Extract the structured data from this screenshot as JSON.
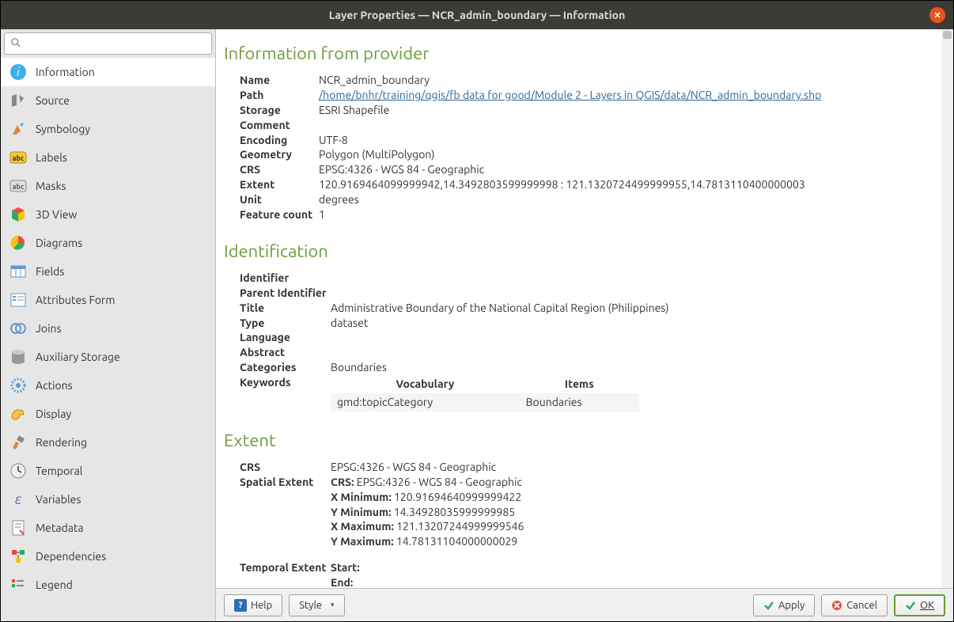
{
  "titlebar": {
    "title": "Layer Properties — NCR_admin_boundary — Information"
  },
  "search": {
    "placeholder": ""
  },
  "sidebar": {
    "items": [
      {
        "label": "Information",
        "active": true
      },
      {
        "label": "Source"
      },
      {
        "label": "Symbology"
      },
      {
        "label": "Labels"
      },
      {
        "label": "Masks"
      },
      {
        "label": "3D View"
      },
      {
        "label": "Diagrams"
      },
      {
        "label": "Fields"
      },
      {
        "label": "Attributes Form"
      },
      {
        "label": "Joins"
      },
      {
        "label": "Auxiliary Storage"
      },
      {
        "label": "Actions"
      },
      {
        "label": "Display"
      },
      {
        "label": "Rendering"
      },
      {
        "label": "Temporal"
      },
      {
        "label": "Variables"
      },
      {
        "label": "Metadata"
      },
      {
        "label": "Dependencies"
      },
      {
        "label": "Legend"
      }
    ]
  },
  "sections": {
    "provider_h": "Information from provider",
    "ident_h": "Identification",
    "extent_h": "Extent"
  },
  "provider": {
    "name_l": "Name",
    "name": "NCR_admin_boundary",
    "path_l": "Path",
    "path": "/home/bnhr/training/qgis/fb data for good/Module 2 - Layers in QGIS/data/NCR_admin_boundary.shp",
    "storage_l": "Storage",
    "storage": "ESRI Shapefile",
    "comment_l": "Comment",
    "comment": "",
    "encoding_l": "Encoding",
    "encoding": "UTF-8",
    "geometry_l": "Geometry",
    "geometry": "Polygon (MultiPolygon)",
    "crs_l": "CRS",
    "crs": "EPSG:4326 - WGS 84 - Geographic",
    "extent_l": "Extent",
    "extent": "120.9169464099999942,14.3492803599999998 : 121.1320724499999955,14.7813110400000003",
    "unit_l": "Unit",
    "unit": "degrees",
    "feat_l": "Feature count",
    "feat": "1"
  },
  "ident": {
    "identifier_l": "Identifier",
    "identifier": "",
    "parent_l": "Parent Identifier",
    "parent": "",
    "title_l": "Title",
    "title": "Administrative Boundary of the National Capital Region (Philippines)",
    "type_l": "Type",
    "type": "dataset",
    "lang_l": "Language",
    "lang": "",
    "abstract_l": "Abstract",
    "abstract": "",
    "cat_l": "Categories",
    "cat": "Boundaries",
    "kw_l": "Keywords",
    "kw_th1": "Vocabulary",
    "kw_th2": "Items",
    "kw_td1": "gmd:topicCategory",
    "kw_td2": "Boundaries"
  },
  "extent": {
    "crs_l": "CRS",
    "crs": "EPSG:4326 - WGS 84 - Geographic",
    "spatial_l": "Spatial Extent",
    "se_crs_l": "CRS:",
    "se_crs": " EPSG:4326 - WGS 84 - Geographic",
    "xmin_l": "X Minimum:",
    "xmin": " 120.91694640999999422",
    "ymin_l": "Y Minimum:",
    "ymin": " 14.34928035999999985",
    "xmax_l": "X Maximum:",
    "xmax": " 121.13207244999999546",
    "ymax_l": "Y Maximum:",
    "ymax": " 14.78131104000000029",
    "temporal_l": "Temporal Extent",
    "start_l": "Start:",
    "end_l": "End:"
  },
  "footer": {
    "help": "Help",
    "style": "Style",
    "apply": "Apply",
    "cancel": "Cancel",
    "ok": "OK"
  }
}
